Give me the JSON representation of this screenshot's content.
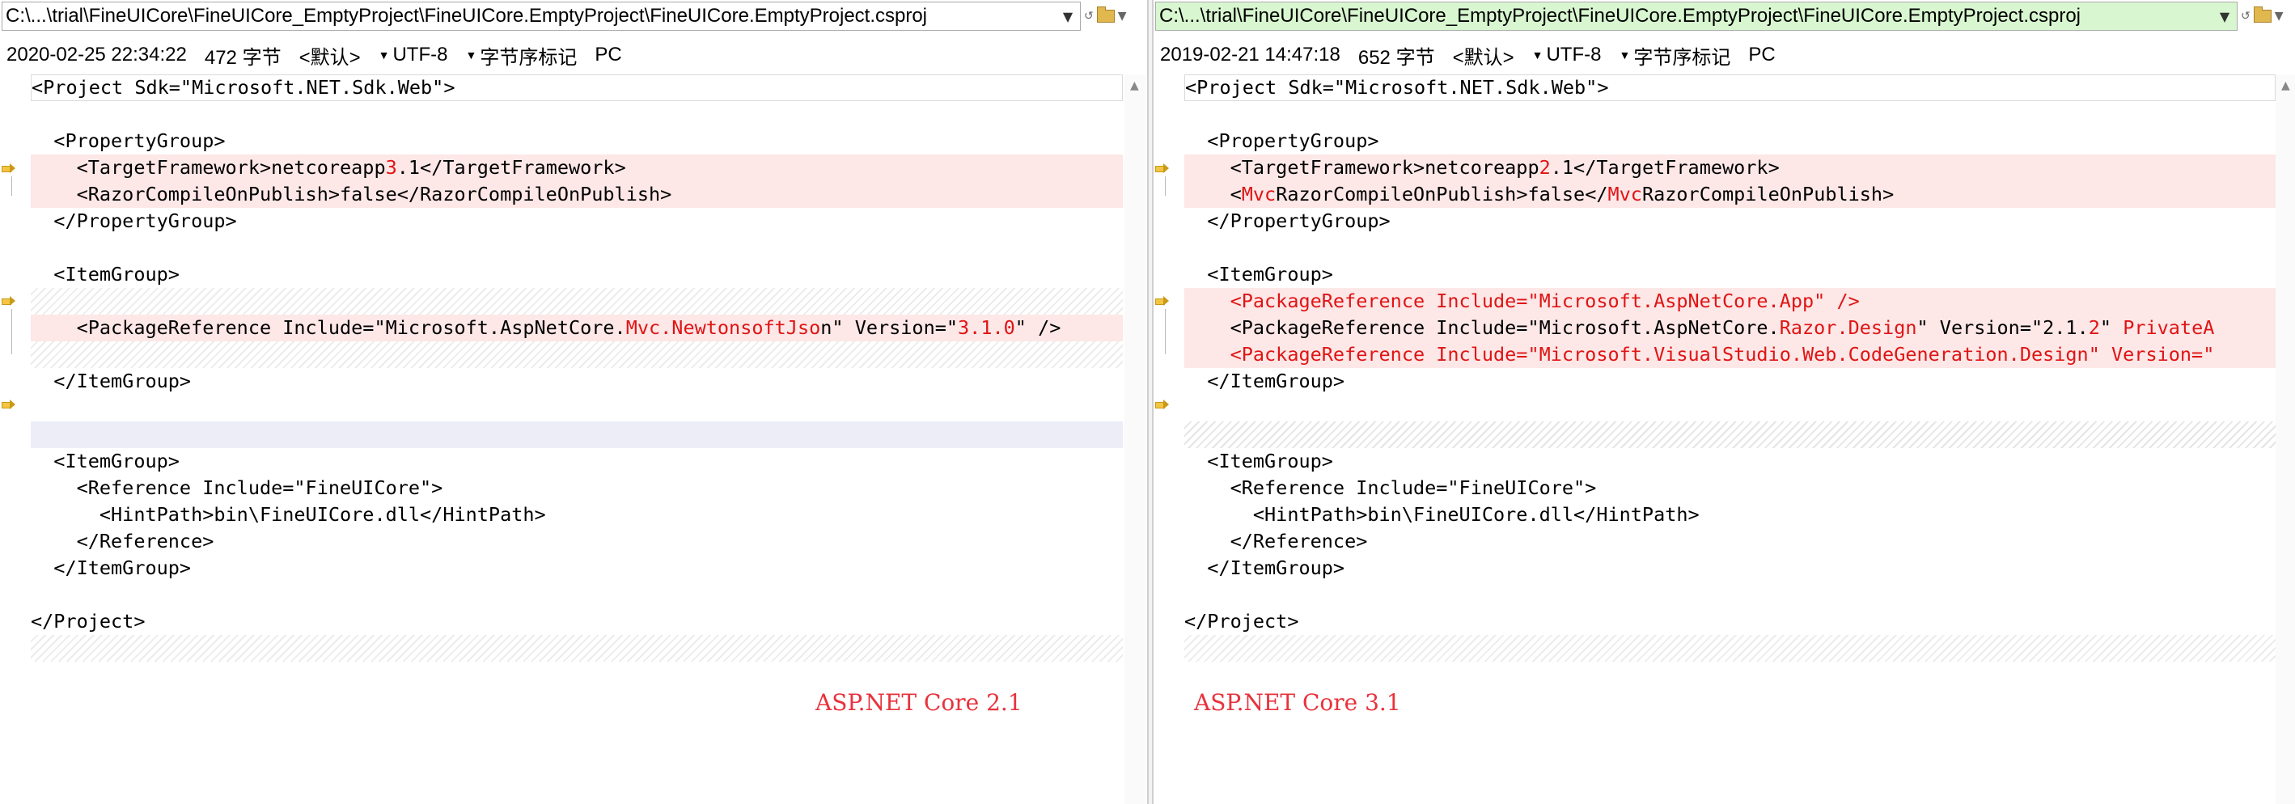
{
  "left": {
    "path": "C:\\...\\trial\\FineUICore\\FineUICore_EmptyProject\\FineUICore.EmptyProject\\FineUICore.EmptyProject.csproj",
    "date": "2020-02-25 22:34:22",
    "size": "472 字节",
    "default": "<默认>",
    "encoding": "UTF-8",
    "bom": "字节序标记",
    "line_ending": "PC",
    "annotation": "ASP.NET Core 2.1"
  },
  "right": {
    "path": "C:\\...\\trial\\FineUICore\\FineUICore_EmptyProject\\FineUICore.EmptyProject\\FineUICore.EmptyProject.csproj",
    "date": "2019-02-21 14:47:18",
    "size": "652 字节",
    "default": "<默认>",
    "encoding": "UTF-8",
    "bom": "字节序标记",
    "line_ending": "PC",
    "annotation": "ASP.NET Core 3.1"
  },
  "code": {
    "project_open": "<Project Sdk=\"Microsoft.NET.Sdk.Web\">",
    "propgroup_open": "  <PropertyGroup>",
    "tf_a": "    <TargetFramework>netcoreapp",
    "tf_left_ver": "3",
    "tf_right_ver": "2",
    "tf_b": ".1</TargetFramework>",
    "razor_left": "    <RazorCompileOnPublish>false</RazorCompileOnPublish>",
    "razor_indent": "    <",
    "mvc": "Mvc",
    "razor_mid": "RazorCompileOnPublish>false</",
    "razor_end": "RazorCompileOnPublish>",
    "propgroup_close": "  </PropertyGroup>",
    "itemgroup_open": "  <ItemGroup>",
    "itemgroup_close": "  </ItemGroup>",
    "pkg_left_a": "    <PackageReference Include=\"Microsoft.AspNetCore.",
    "pkg_left_hl1": "Mvc.NewtonsoftJso",
    "pkg_left_b": "n\" Version=\"",
    "pkg_left_hl2": "3.1.0",
    "pkg_left_c": "\" />",
    "pkg_right1": "    <PackageReference Include=\"Microsoft.AspNetCore.App\" />",
    "pkg_right2_a": "    <PackageReference Include=\"Microsoft.AspNetCore.",
    "pkg_right2_hl1": "Razor.Design",
    "pkg_right2_b": "\" Version=\"2.1.",
    "pkg_right2_hl2": "2",
    "pkg_right2_c": "\" ",
    "pkg_right2_hl3": "PrivateA",
    "pkg_right3": "    <PackageReference Include=\"Microsoft.VisualStudio.Web.CodeGeneration.Design\" Version=\"",
    "reference_open": "    <Reference Include=\"FineUICore\">",
    "hintpath": "      <HintPath>bin\\FineUICore.dll</HintPath>",
    "reference_close": "    </Reference>",
    "project_close": "</Project>"
  },
  "icons": {
    "dropdown": "chevron-down-icon",
    "diff_marker": "diff-arrow-icon",
    "scroll_up": "scroll-up-icon",
    "folder": "folder-icon"
  }
}
